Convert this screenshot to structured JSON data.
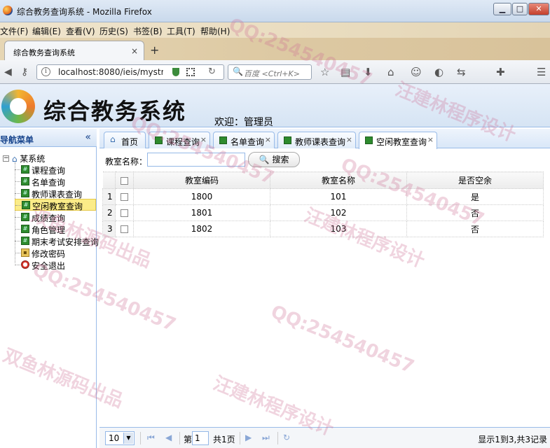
{
  "window": {
    "title": "综合教务查询系统 - Mozilla Firefox",
    "min": "▁",
    "max": "□",
    "close": "✕"
  },
  "menu": [
    "文件(F)",
    "编辑(E)",
    "查看(V)",
    "历史(S)",
    "书签(B)",
    "工具(T)",
    "帮助(H)"
  ],
  "browser_tab": {
    "title": "综合教务查询系统",
    "close": "×",
    "new": "+"
  },
  "address_bar": {
    "url": "localhost:8080/ieis/mystru",
    "search_placeholder": "百度 <Ctrl+K>"
  },
  "header": {
    "system_name": "综合教务系统",
    "welcome": "欢迎：管理员"
  },
  "nav": {
    "title": "导航菜单",
    "collapse": "«",
    "root": "某系统",
    "items": [
      {
        "label": "课程查询",
        "icon": "grid-icon"
      },
      {
        "label": "名单查询",
        "icon": "grid-icon"
      },
      {
        "label": "教师课表查询",
        "icon": "grid-icon"
      },
      {
        "label": "空闲教室查询",
        "icon": "grid-icon",
        "selected": true
      },
      {
        "label": "成绩查询",
        "icon": "grid-icon"
      },
      {
        "label": "角色管理",
        "icon": "grid-icon"
      },
      {
        "label": "期末考试安排查询",
        "icon": "grid-icon"
      },
      {
        "label": "修改密码",
        "icon": "lock-icon"
      },
      {
        "label": "安全退出",
        "icon": "exit-icon"
      }
    ]
  },
  "tabs": [
    {
      "label": "首页",
      "closable": false
    },
    {
      "label": "课程查询",
      "closable": true
    },
    {
      "label": "名单查询",
      "closable": true
    },
    {
      "label": "教师课表查询",
      "closable": true
    },
    {
      "label": "空闲教室查询",
      "closable": true,
      "active": true
    }
  ],
  "search": {
    "label": "教室名称：",
    "value": "",
    "button": "搜索"
  },
  "table": {
    "columns": [
      "教室编码",
      "教室名称",
      "是否空余"
    ],
    "rows": [
      {
        "n": "1",
        "code": "1800",
        "name": "101",
        "free": "是"
      },
      {
        "n": "2",
        "code": "1801",
        "name": "102",
        "free": "否"
      },
      {
        "n": "3",
        "code": "1802",
        "name": "103",
        "free": "否"
      }
    ]
  },
  "pager": {
    "page_size": "10",
    "page_prefix": "第",
    "page": "1",
    "page_suffix": "共1页",
    "info": "显示1到3,共3记录"
  },
  "watermarks": [
    "QQ:254540457",
    "汪建林程序设计",
    "双鱼林源码出品"
  ]
}
